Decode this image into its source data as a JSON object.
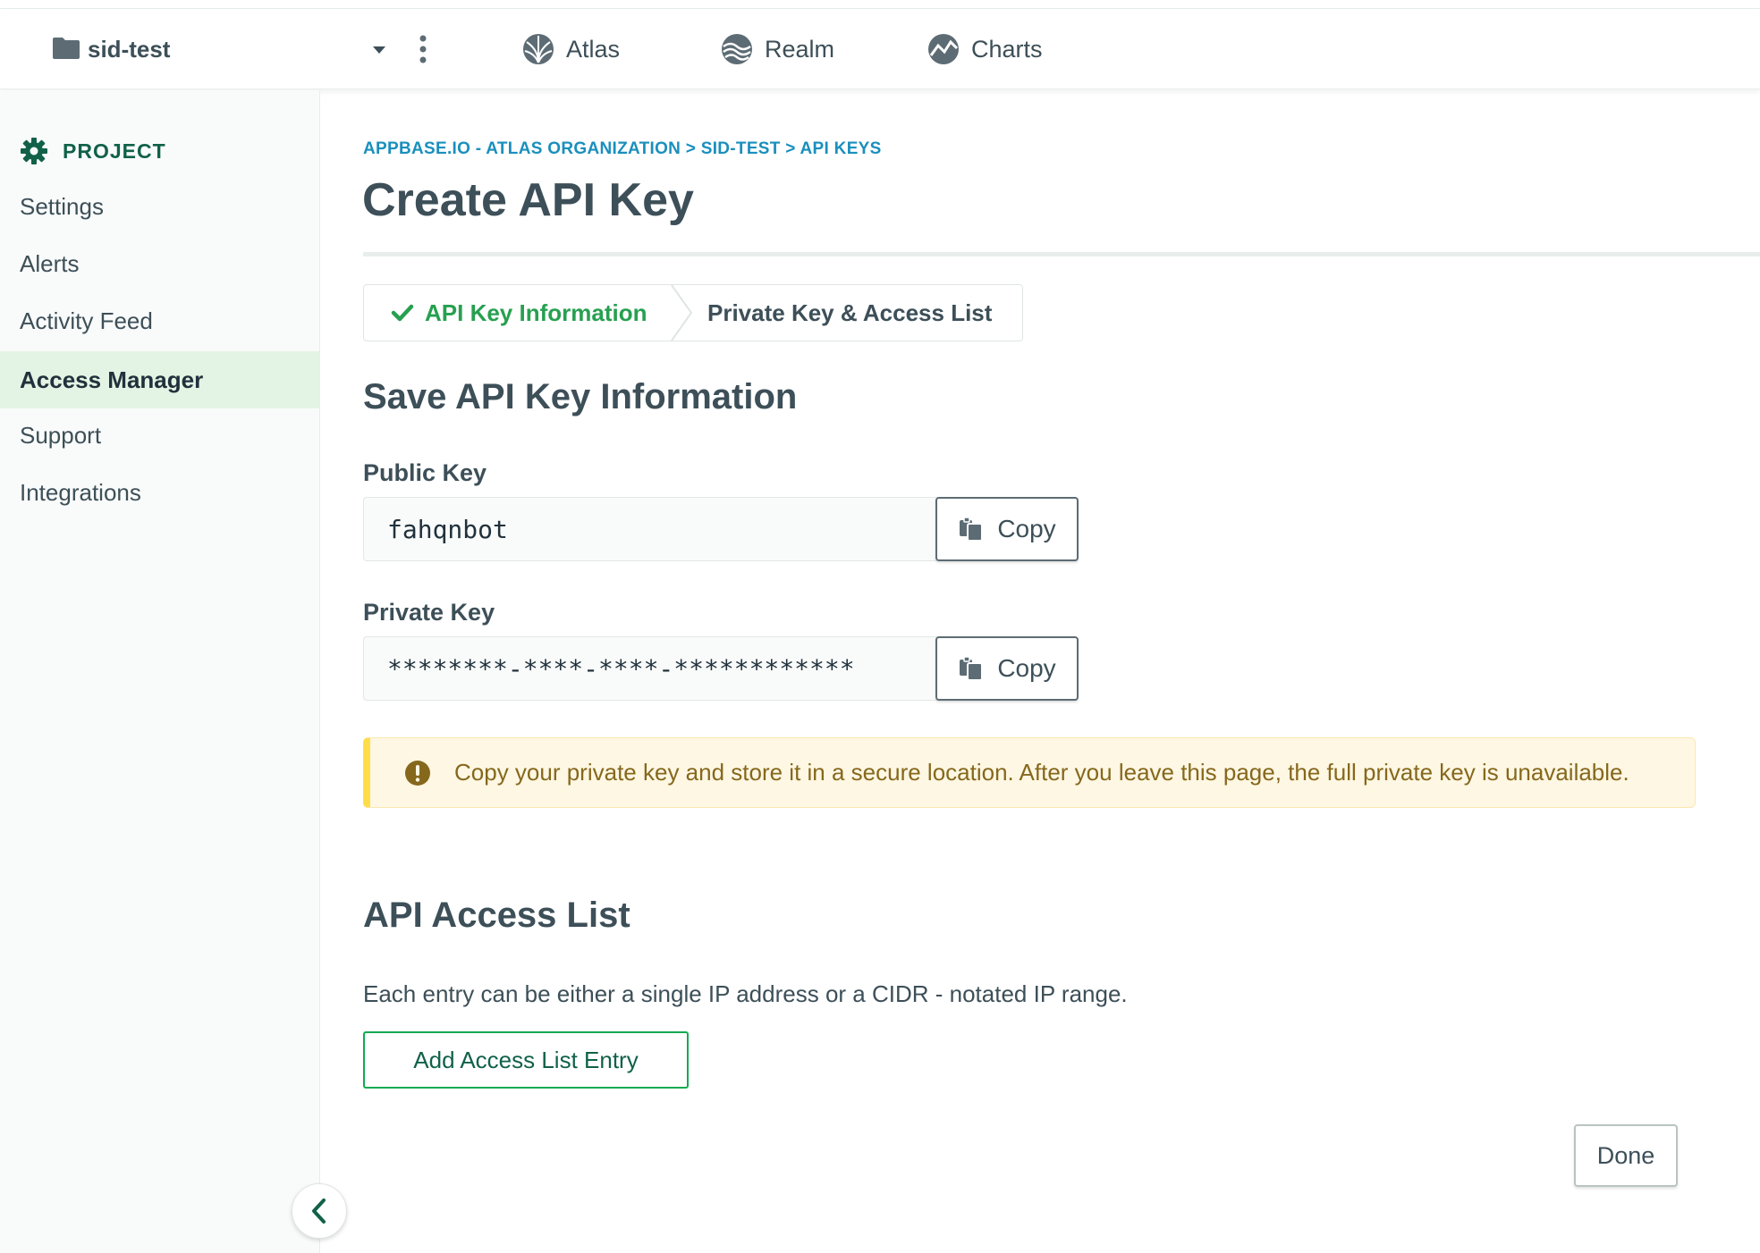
{
  "topbar": {
    "project_name": "sid-test",
    "tabs": [
      {
        "label": "Atlas",
        "icon": "atlas-icon"
      },
      {
        "label": "Realm",
        "icon": "realm-icon"
      },
      {
        "label": "Charts",
        "icon": "charts-icon"
      }
    ]
  },
  "sidebar": {
    "header": "PROJECT",
    "items": [
      {
        "label": "Settings",
        "active": false
      },
      {
        "label": "Alerts",
        "active": false
      },
      {
        "label": "Activity Feed",
        "active": false
      },
      {
        "label": "Access Manager",
        "active": true
      },
      {
        "label": "Support",
        "active": false
      },
      {
        "label": "Integrations",
        "active": false
      }
    ]
  },
  "main": {
    "breadcrumb": "APPBASE.IO - ATLAS ORGANIZATION > SID-TEST > API KEYS",
    "title": "Create API Key",
    "wizard": {
      "step1": "API Key Information",
      "step2": "Private Key & Access List"
    },
    "save_section_title": "Save API Key Information",
    "public_key": {
      "label": "Public Key",
      "value": "fahqnbot",
      "copy_label": "Copy"
    },
    "private_key": {
      "label": "Private Key",
      "value": "********-****-****-************",
      "copy_label": "Copy"
    },
    "warning": "Copy your private key and store it in a secure location. After you leave this page, the full private key is unavailable.",
    "access_list": {
      "title": "API Access List",
      "help": "Each entry can be either a single IP address or a CIDR - notated IP range.",
      "add_button": "Add Access List Entry"
    },
    "done_button": "Done"
  },
  "colors": {
    "accent_green": "#13aa52",
    "dark_green": "#116149",
    "link_blue": "#1a8fbd",
    "warning_bg": "#fef7e3",
    "warning_text": "#86681d"
  }
}
